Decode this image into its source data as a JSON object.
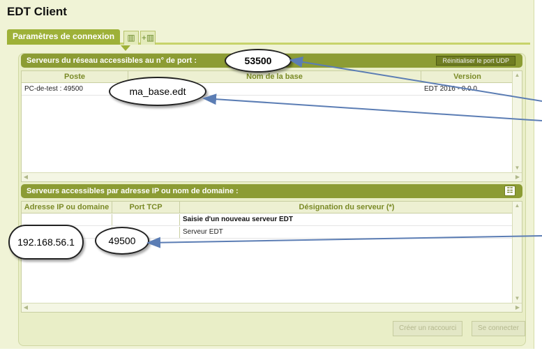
{
  "app": {
    "title": "EDT Client"
  },
  "tabs": [
    {
      "label": "Paramètres de connexion",
      "icon": "server-list-icon"
    },
    {
      "label": "",
      "icon": "add-server-icon"
    }
  ],
  "network_section": {
    "title": "Serveurs du réseau accessibles au n° de port :",
    "port_value": "53500",
    "reset_button": "Réinitialiser le port UDP",
    "columns": [
      "Poste",
      "Nom de la base",
      "Version"
    ],
    "rows": [
      {
        "poste": "PC-de-test : 49500",
        "base": "ma_base.edt",
        "version": "EDT 2016 - 0.0.0"
      }
    ]
  },
  "ip_section": {
    "title": "Serveurs accessibles par adresse IP ou nom de domaine :",
    "icon": "server-config-icon",
    "columns": [
      "Adresse IP ou domaine",
      "Port TCP",
      "Désignation du serveur (*)"
    ],
    "new_row_label": "Saisie d'un nouveau serveur EDT",
    "rows": [
      {
        "address": "192.168.56.1",
        "port": "49500",
        "designation": "Serveur EDT"
      }
    ]
  },
  "footer": {
    "shortcut_button": "Créer un raccourci",
    "connect_button": "Se connecter"
  },
  "colors": {
    "background": "#f0f3d6",
    "accent": "#9eb138",
    "header": "#8c9c34",
    "arrow": "#5b7db4"
  }
}
